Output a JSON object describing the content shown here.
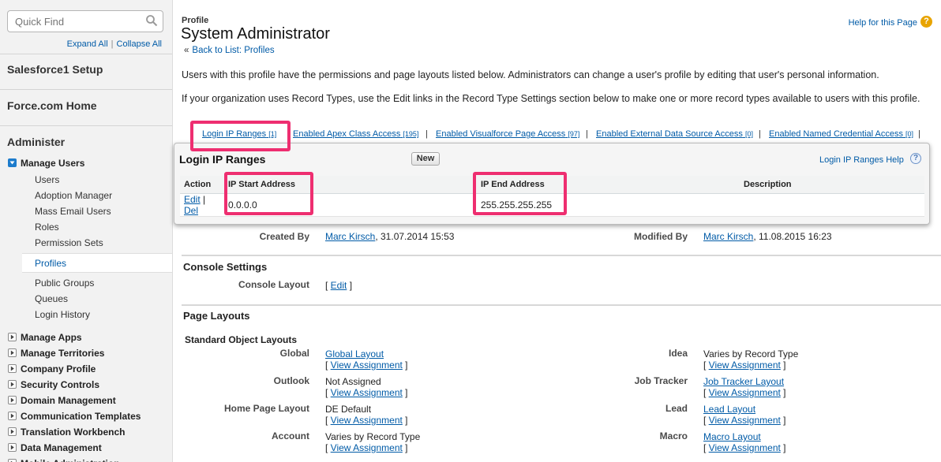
{
  "sidebar": {
    "search_placeholder": "Quick Find",
    "expand_all": "Expand All",
    "collapse_all": "Collapse All",
    "headings": [
      "Salesforce1 Setup",
      "Force.com Home",
      "Administer"
    ],
    "manage_users": {
      "label": "Manage Users",
      "items": [
        "Users",
        "Adoption Manager",
        "Mass Email Users",
        "Roles",
        "Permission Sets",
        "Profiles",
        "Public Groups",
        "Queues",
        "Login History"
      ],
      "selected": "Profiles"
    },
    "groups": [
      "Manage Apps",
      "Manage Territories",
      "Company Profile",
      "Security Controls",
      "Domain Management",
      "Communication Templates",
      "Translation Workbench",
      "Data Management",
      "Mobile Administration"
    ]
  },
  "header": {
    "page_type": "Profile",
    "title": "System Administrator",
    "back_link": "Back to List: Profiles",
    "help_link": "Help for this Page"
  },
  "intro": {
    "para1": "Users with this profile have the permissions and page layouts listed below. Administrators can change a user's profile by editing that user's personal information.",
    "para2": "If your organization uses Record Types, use the Edit links in the Record Type Settings section below to make one or more record types available to users with this profile."
  },
  "related_links": [
    {
      "label": "Login IP Ranges",
      "count": "[1]"
    },
    {
      "label": "Enabled Apex Class Access",
      "count": "[195]"
    },
    {
      "label": "Enabled Visualforce Page Access",
      "count": "[97]"
    },
    {
      "label": "Enabled External Data Source Access",
      "count": "[0]"
    },
    {
      "label": "Enabled Named Credential Access",
      "count": "[0]"
    }
  ],
  "login_ip_ranges": {
    "title": "Login IP Ranges",
    "new_button": "New",
    "help": "Login IP Ranges Help",
    "columns": [
      "Action",
      "IP Start Address",
      "IP End Address",
      "Description"
    ],
    "rows": [
      {
        "edit": "Edit",
        "del": "Del",
        "start": "0.0.0.0",
        "end": "255.255.255.255",
        "description": ""
      }
    ]
  },
  "detail": {
    "created_by_label": "Created By",
    "created_by_name": "Marc Kirsch",
    "created_by_date": ", 31.07.2014 15:53",
    "modified_by_label": "Modified By",
    "modified_by_name": "Marc Kirsch",
    "modified_by_date": ", 11.08.2015 16:23"
  },
  "console_settings": {
    "title": "Console Settings",
    "layout_label": "Console Layout",
    "edit": "Edit"
  },
  "page_layouts": {
    "title": "Page Layouts",
    "subtitle": "Standard Object Layouts",
    "view_assignment": "View Assignment",
    "left": [
      {
        "label": "Global",
        "value": "Global Layout",
        "link": true
      },
      {
        "label": "Outlook",
        "value": "Not Assigned",
        "link": false
      },
      {
        "label": "Home Page Layout",
        "value": "DE Default",
        "link": false
      },
      {
        "label": "Account",
        "value": "Varies by Record Type",
        "link": false
      }
    ],
    "right": [
      {
        "label": "Idea",
        "value": "Varies by Record Type",
        "link": false
      },
      {
        "label": "Job Tracker",
        "value": "Job Tracker Layout",
        "link": true
      },
      {
        "label": "Lead",
        "value": "Lead Layout",
        "link": true
      },
      {
        "label": "Macro",
        "value": "Macro Layout",
        "link": true
      }
    ]
  }
}
